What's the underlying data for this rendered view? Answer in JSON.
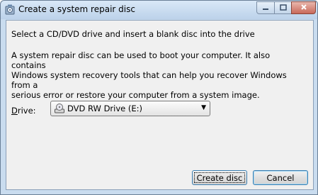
{
  "window": {
    "title": "Create a system repair disc",
    "controls": {
      "minimize": "minimize-icon",
      "maximize": "maximize-icon",
      "close": "close-icon"
    }
  },
  "content": {
    "heading": "Select a CD/DVD drive and insert a blank disc into the drive",
    "description": "A system repair disc can be used to boot your computer. It also contains\nWindows system recovery tools that can help you recover Windows from a\nserious error or restore your computer from a system image.",
    "drive_label_access": "D",
    "drive_label_rest": "rive:",
    "drive_select": {
      "selected": "DVD RW Drive (E:)",
      "icon": "dvd-drive-icon"
    }
  },
  "buttons": {
    "create": "Create disc",
    "cancel": "Cancel"
  }
}
